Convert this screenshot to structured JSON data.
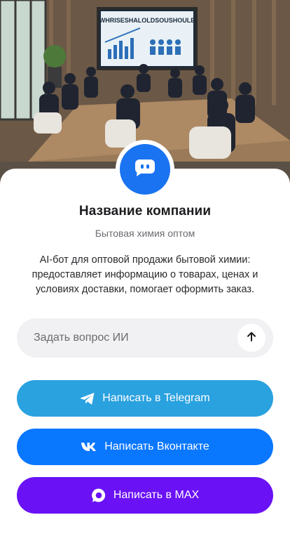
{
  "hero": {
    "screen_text": "WHRISESHALOLDSOUSHOULE"
  },
  "company": {
    "name": "Название компании",
    "category": "Бытовая химия оптом",
    "description": "AI-бот для оптовой продажи бытовой химии: предоставляет информацию о товарах, ценах и условиях доставки, помогает оформить заказ."
  },
  "ask": {
    "placeholder": "Задать вопрос ИИ"
  },
  "buttons": {
    "telegram": "Написать в Telegram",
    "vk": "Написать Вконтакте",
    "max": "Написать в MAX"
  },
  "colors": {
    "avatar": "#1a73f0",
    "telegram": "#2aa2e0",
    "vk": "#0a77ff",
    "max": "#6a12f5"
  },
  "icons": {
    "avatar": "chat-bot-icon",
    "send": "arrow-up-icon",
    "telegram": "telegram-icon",
    "vk": "vk-icon",
    "max": "max-icon"
  }
}
